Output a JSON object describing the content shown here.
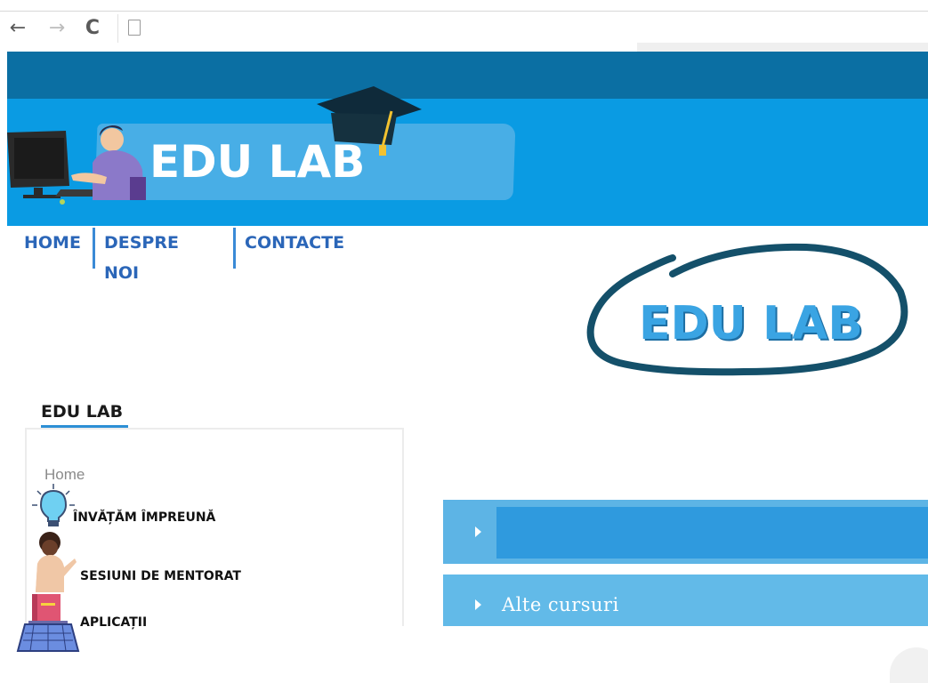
{
  "browser": {
    "back_icon": "←",
    "forward_icon": "→",
    "reload_icon": "C"
  },
  "header": {
    "title": "EDU LAB"
  },
  "topnav": {
    "items": [
      "HOME",
      "DESPRE NOI",
      "CONTACTE"
    ]
  },
  "logo": {
    "text": "EDU LAB"
  },
  "widget": {
    "title": "EDU LAB",
    "home": "Home",
    "items": [
      "ÎNVĂȚĂM ÎMPREUNĂ",
      "SESIUNI DE MENTORAT",
      "APLICAȚII"
    ]
  },
  "accordion": {
    "items": [
      "",
      "Alte cursuri"
    ]
  },
  "colors": {
    "header_dark": "#0b6fa3",
    "header_main": "#0a9be3",
    "nav_text": "#2b66b8",
    "accordion_1": "#2f9ade",
    "accordion_2": "#62bae8"
  }
}
